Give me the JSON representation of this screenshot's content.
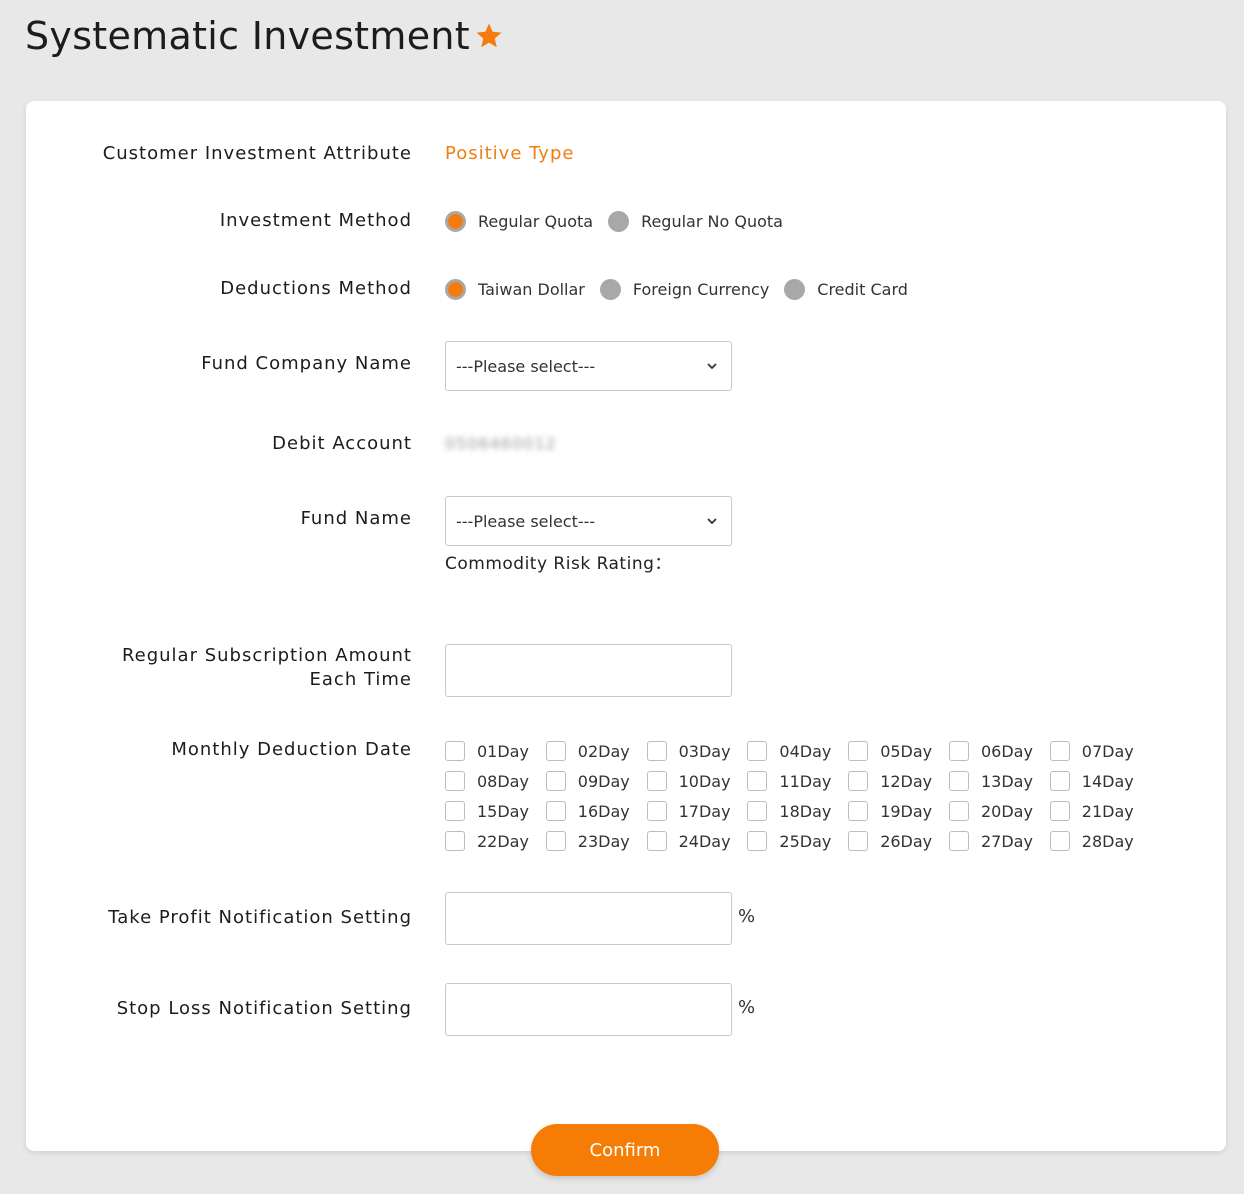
{
  "page": {
    "title": "Systematic Investment",
    "accent_color": "#f47b0f",
    "star_icon": "star-icon"
  },
  "form": {
    "attribute": {
      "label": "Customer Investment Attribute",
      "value": "Positive Type"
    },
    "investment_method": {
      "label": "Investment Method",
      "options": [
        {
          "label": "Regular Quota",
          "checked": true
        },
        {
          "label": "Regular No Quota",
          "checked": false
        }
      ]
    },
    "deductions_method": {
      "label": "Deductions Method",
      "options": [
        {
          "label": "Taiwan Dollar",
          "checked": true
        },
        {
          "label": "Foreign Currency",
          "checked": false
        },
        {
          "label": "Credit Card",
          "checked": false
        }
      ]
    },
    "fund_company": {
      "label": "Fund Company Name",
      "selected": "---Please select---"
    },
    "debit_account": {
      "label": "Debit Account",
      "value": "0506460012"
    },
    "fund_name": {
      "label": "Fund Name",
      "selected": "---Please select---",
      "risk_label": "Commodity Risk Rating："
    },
    "subscription": {
      "label_line1": "Regular Subscription Amount",
      "label_line2": "Each Time",
      "value": ""
    },
    "deduction_date": {
      "label": "Monthly Deduction Date",
      "days": [
        "01Day",
        "02Day",
        "03Day",
        "04Day",
        "05Day",
        "06Day",
        "07Day",
        "08Day",
        "09Day",
        "10Day",
        "11Day",
        "12Day",
        "13Day",
        "14Day",
        "15Day",
        "16Day",
        "17Day",
        "18Day",
        "19Day",
        "20Day",
        "21Day",
        "22Day",
        "23Day",
        "24Day",
        "25Day",
        "26Day",
        "27Day",
        "28Day"
      ]
    },
    "take_profit": {
      "label": "Take Profit Notification Setting",
      "value": "",
      "unit": "%"
    },
    "stop_loss": {
      "label": "Stop Loss Notification Setting",
      "value": "",
      "unit": "%"
    }
  },
  "actions": {
    "confirm_label": "Confirm"
  }
}
